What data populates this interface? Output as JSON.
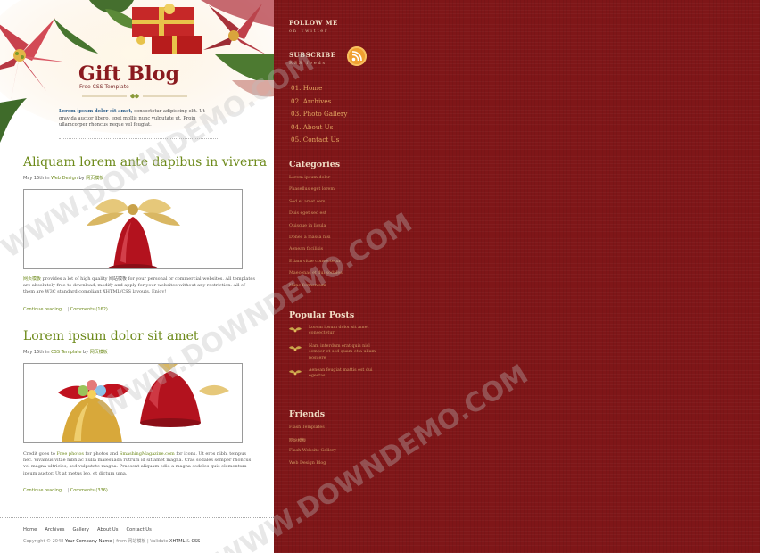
{
  "blog": {
    "title": "Gift Blog",
    "subtitle": "Free CSS Template",
    "intro_lead": "Lorem ipsum dolor sit amet,",
    "intro_text": " consectetur adipiscing elit. Ut gravida auctor libero, eget mollis nunc vulputate ut. Proin ullamcorper rhoncus neque vel feugiat."
  },
  "posts": [
    {
      "title": "Aliquam lorem ante dapibus in viverra",
      "meta_prefix": "May 15th in ",
      "meta_category": "Web Design",
      "meta_by": " by ",
      "meta_author": "网页模板",
      "text_lead": "网页模板",
      "text": " provides a lot of high quality 网站模板 for your personal or commercial websites. All templates are absolutely free to download, modify and apply for your websites without any restriction. All of them are W3C standard compliant XHTML/CSS layouts. Enjoy!",
      "more": "Continue reading...",
      "sep": " | ",
      "comments": "Comments (162)"
    },
    {
      "title": "Lorem ipsum dolor sit amet",
      "meta_prefix": "May 15th in ",
      "meta_category": "CSS Template",
      "meta_by": " by ",
      "meta_author": "网页模板",
      "text_pre": "Credit goes to ",
      "text_link1": "Free photos",
      "text_mid": " for photos and ",
      "text_link2": "SmashingMagazine.com",
      "text": " for icons. Ut eros nibh, tempus nec. Vivamus vitae nibh ac nulla malesuada rutrum id sit amet magna. Cras sodales semper rhoncus vel magna ultricies, sed vulputate magna. Praesent aliquam odio a magna sodales quis elementum ipsum auctor. Ut at metus leo, et dictum uma.",
      "more": "Continue reading...",
      "sep": " | ",
      "comments": "Comments (336)"
    }
  ],
  "footer": {
    "nav": [
      "Home",
      "Archives",
      "Gallery",
      "About Us",
      "Contact Us"
    ],
    "copy_pre": "Copyright © 2048 ",
    "company": "Your Company Name",
    "copy_mid": " | from 网站模板 | Validate ",
    "xhtml": "XHTML",
    "amp": " & ",
    "css": "CSS"
  },
  "sidebar": {
    "follow_title": "FOLLOW ME",
    "follow_sub": "on Twitter",
    "subscribe_title": "SUBSCRIBE",
    "subscribe_sub": "RSS feeds",
    "nav": [
      "01. Home",
      "02. Archives",
      "03. Photo Gallery",
      "04. About Us",
      "05. Contact Us"
    ],
    "categories_title": "Categories",
    "categories": [
      "Lorem ipsum dolor",
      "Phasellus eget lorem",
      "Sed et amet sem",
      "Duis eget sed est",
      "Quisque in ligula",
      "Donec a massa nisi",
      "Aenean facilisis",
      "Etiam vitae consectetur",
      "Maecenas et dui sodales",
      "Nunc fermentum"
    ],
    "popular_title": "Popular Posts",
    "popular": [
      "Lorem ipsum dolor sit amet consectetur",
      "Nam interdum erat quis nisl semper et sed quam et a ullam posuere",
      "Aenean feugiat mattis est dui egestas"
    ],
    "friends_title": "Friends",
    "friends": [
      "Flash Templates",
      "网站模板",
      "Flash Website Gallery",
      "Web Design Blog"
    ]
  },
  "watermark": "WWW.DOWNDEMO.COM",
  "colors": {
    "accent_red": "#8a1a1f",
    "post_title_green": "#6d8a1a",
    "sidebar_bg": "#7f1618",
    "sidebar_link": "#e3a862"
  }
}
